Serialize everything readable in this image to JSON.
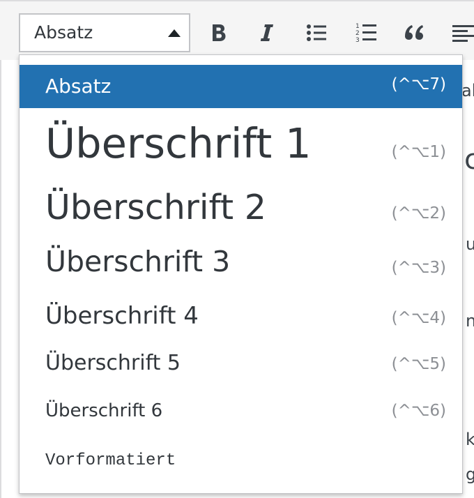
{
  "toolbar": {
    "format_select": {
      "value": "Absatz"
    },
    "buttons": [
      {
        "name": "bold-button",
        "icon": "bold-icon",
        "glyph": "B"
      },
      {
        "name": "italic-button",
        "icon": "italic-icon",
        "glyph": "I"
      },
      {
        "name": "bullet-list-button",
        "icon": "bullet-list-icon"
      },
      {
        "name": "numbered-list-button",
        "icon": "numbered-list-icon"
      },
      {
        "name": "blockquote-button",
        "icon": "blockquote-icon",
        "glyph": "❝"
      },
      {
        "name": "align-left-button",
        "icon": "align-left-icon"
      }
    ]
  },
  "background_peek": [
    "ab",
    "c",
    "u",
    "n",
    "k",
    "g"
  ],
  "dropdown": {
    "items": [
      {
        "label": "Absatz",
        "shortcut": "(^⌥7)",
        "selected": true
      },
      {
        "label": "Überschrift 1",
        "shortcut": "(^⌥1)"
      },
      {
        "label": "Überschrift 2",
        "shortcut": "(^⌥2)"
      },
      {
        "label": "Überschrift 3",
        "shortcut": "(^⌥3)"
      },
      {
        "label": "Überschrift 4",
        "shortcut": "(^⌥4)"
      },
      {
        "label": "Überschrift 5",
        "shortcut": "(^⌥5)"
      },
      {
        "label": "Überschrift 6",
        "shortcut": "(^⌥6)"
      },
      {
        "label": "Vorformatiert"
      }
    ]
  },
  "colors": {
    "selected_background": "#2271b1",
    "text": "#32373c",
    "shortcut": "#8c8f94"
  }
}
